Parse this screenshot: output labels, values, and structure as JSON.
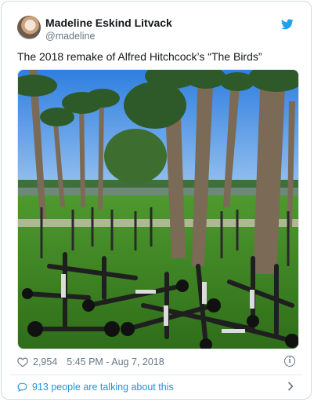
{
  "tweet": {
    "author_name": "Madeline Eskind Litvack",
    "author_handle": "@madeline",
    "text": "The 2018 remake of Alfred Hitchcock’s “The Birds”",
    "likes": "2,954",
    "timestamp": "5:45 PM - Aug 7, 2018",
    "conversation_link": "913 people are talking about this"
  },
  "icons": {
    "brand": "twitter-bird-icon",
    "like": "heart-icon",
    "info": "info-icon",
    "conversation": "speech-bubble-icon",
    "more": "chevron-right-icon"
  },
  "colors": {
    "brand_blue": "#1da1f2",
    "link_blue": "#1b95e0",
    "secondary_text": "#657786",
    "primary_text": "#14171a"
  }
}
